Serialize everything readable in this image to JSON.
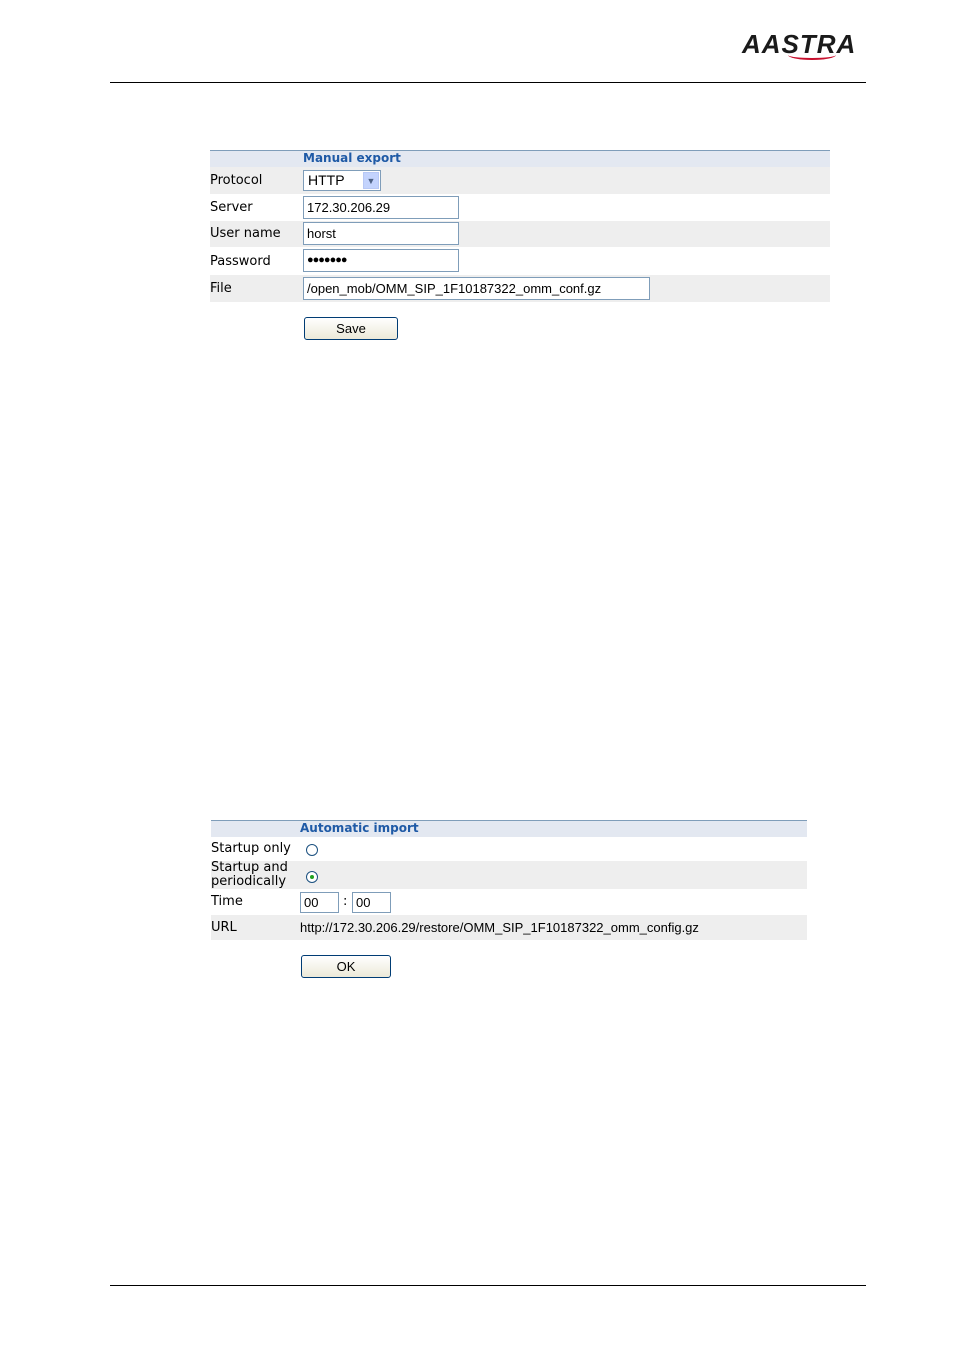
{
  "brand": {
    "logo_text": "AASTRA"
  },
  "manual_export": {
    "title": "Manual export",
    "protocol": {
      "label": "Protocol",
      "value": "HTTP"
    },
    "server": {
      "label": "Server",
      "value": "172.30.206.29"
    },
    "user_name": {
      "label": "User name",
      "value": "horst"
    },
    "password": {
      "label": "Password",
      "value": "●●●●●●●"
    },
    "file": {
      "label": "File",
      "value": "/open_mob/OMM_SIP_1F10187322_omm_conf.gz"
    },
    "save_label": "Save"
  },
  "automatic_import": {
    "title": "Automatic import",
    "startup_only": {
      "label": "Startup only",
      "selected": false
    },
    "startup_periodic": {
      "label_line1": "Startup and",
      "label_line2": "periodically",
      "selected": true
    },
    "time": {
      "label": "Time",
      "hours": "00",
      "separator": ":",
      "minutes": "00"
    },
    "url": {
      "label": "URL",
      "value": "http://172.30.206.29/restore/OMM_SIP_1F10187322_omm_config.gz"
    },
    "ok_label": "OK"
  },
  "colors": {
    "header_bg": "#e3e8f1",
    "header_text": "#1f5aa6",
    "alt_row": "#eeeeee",
    "input_border": "#7f9db9"
  }
}
